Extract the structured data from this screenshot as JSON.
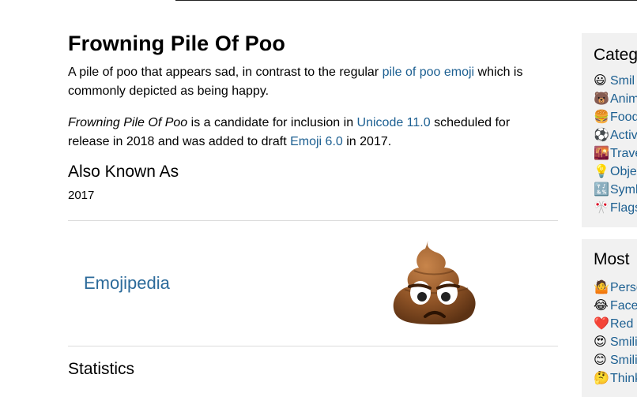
{
  "page": {
    "title": "Frowning Pile Of Poo",
    "intro": {
      "before": "A pile of poo that appears sad, in contrast to the regular ",
      "link": "pile of poo emoji",
      "after": " which is commonly depicted as being happy."
    },
    "candidate": {
      "name": "Frowning Pile Of Poo",
      "text1": " is a candidate for inclusion in ",
      "link1": "Unicode 11.0",
      "text2": " scheduled for release in 2018 and was added to draft ",
      "link2": "Emoji 6.0",
      "text3": " in 2017."
    },
    "also_known_as": {
      "heading": "Also Known As",
      "value": "2017"
    },
    "vendor": {
      "name": "Emojipedia",
      "emoji": "💩"
    },
    "statistics_heading": "Statistics"
  },
  "sidebar": {
    "categories": {
      "heading": "Categ",
      "items": [
        {
          "icon": "😃",
          "icon_name": "smiley-icon",
          "label": "Smil"
        },
        {
          "icon": "🐻",
          "icon_name": "bear-icon",
          "label": "Anim"
        },
        {
          "icon": "🍔",
          "icon_name": "hamburger-icon",
          "label": "Food"
        },
        {
          "icon": "⚽",
          "icon_name": "soccer-ball-icon",
          "label": "Activ"
        },
        {
          "icon": "🌇",
          "icon_name": "sunset-city-icon",
          "label": "Trave"
        },
        {
          "icon": "💡",
          "icon_name": "light-bulb-icon",
          "label": "Obje"
        },
        {
          "icon": "🔣",
          "icon_name": "symbols-icon",
          "label": "Symb"
        },
        {
          "icon": "🎌",
          "icon_name": "crossed-flags-icon",
          "label": "Flags"
        }
      ]
    },
    "most_popular": {
      "heading": "Most",
      "items": [
        {
          "icon": "🤷",
          "icon_name": "person-shrugging-icon",
          "label": "Perso"
        },
        {
          "icon": "😂",
          "icon_name": "face-with-tears-of-joy-icon",
          "label": "Face"
        },
        {
          "icon": "❤️",
          "icon_name": "red-heart-icon",
          "label": "Red"
        },
        {
          "icon": "😍",
          "icon_name": "heart-eyes-icon",
          "label": "Smili"
        },
        {
          "icon": "😊",
          "icon_name": "smiling-face-icon",
          "label": "Smili"
        },
        {
          "icon": "🤔",
          "icon_name": "thinking-face-icon",
          "label": "Think"
        }
      ]
    }
  }
}
